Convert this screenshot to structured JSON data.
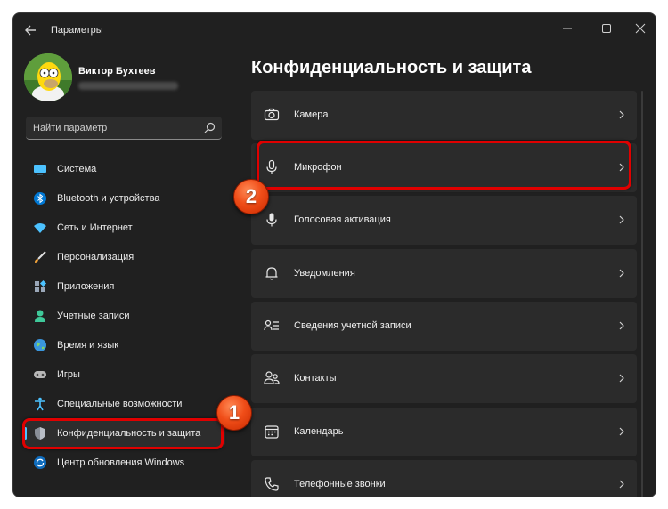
{
  "window": {
    "title": "Параметры"
  },
  "user": {
    "name": "Виктор Бухтеев"
  },
  "search": {
    "placeholder": "Найти параметр"
  },
  "sidebar": {
    "items": [
      {
        "label": "Система",
        "icon": "monitor-icon"
      },
      {
        "label": "Bluetooth и устройства",
        "icon": "bluetooth-icon"
      },
      {
        "label": "Сеть и Интернет",
        "icon": "wifi-icon"
      },
      {
        "label": "Персонализация",
        "icon": "brush-icon"
      },
      {
        "label": "Приложения",
        "icon": "apps-icon"
      },
      {
        "label": "Учетные записи",
        "icon": "person-icon"
      },
      {
        "label": "Время и язык",
        "icon": "globe-icon"
      },
      {
        "label": "Игры",
        "icon": "gamepad-icon"
      },
      {
        "label": "Специальные возможности",
        "icon": "accessibility-icon"
      },
      {
        "label": "Конфиденциальность и защита",
        "icon": "shield-icon",
        "active": true
      },
      {
        "label": "Центр обновления Windows",
        "icon": "update-icon"
      }
    ]
  },
  "main": {
    "title": "Конфиденциальность и защита",
    "rows": [
      {
        "label": "Камера",
        "icon": "camera-icon"
      },
      {
        "label": "Микрофон",
        "icon": "microphone-icon"
      },
      {
        "label": "Голосовая активация",
        "icon": "voice-activation-icon"
      },
      {
        "label": "Уведомления",
        "icon": "bell-icon"
      },
      {
        "label": "Сведения учетной записи",
        "icon": "account-info-icon"
      },
      {
        "label": "Контакты",
        "icon": "contacts-icon"
      },
      {
        "label": "Календарь",
        "icon": "calendar-icon"
      },
      {
        "label": "Телефонные звонки",
        "icon": "phone-icon"
      }
    ]
  },
  "annotations": {
    "step1": "1",
    "step2": "2"
  },
  "colors": {
    "background": "#202020",
    "card": "#2b2b2b",
    "accent": "#4cc2ff",
    "highlight": "#e00000",
    "badge": "#f04d18"
  }
}
